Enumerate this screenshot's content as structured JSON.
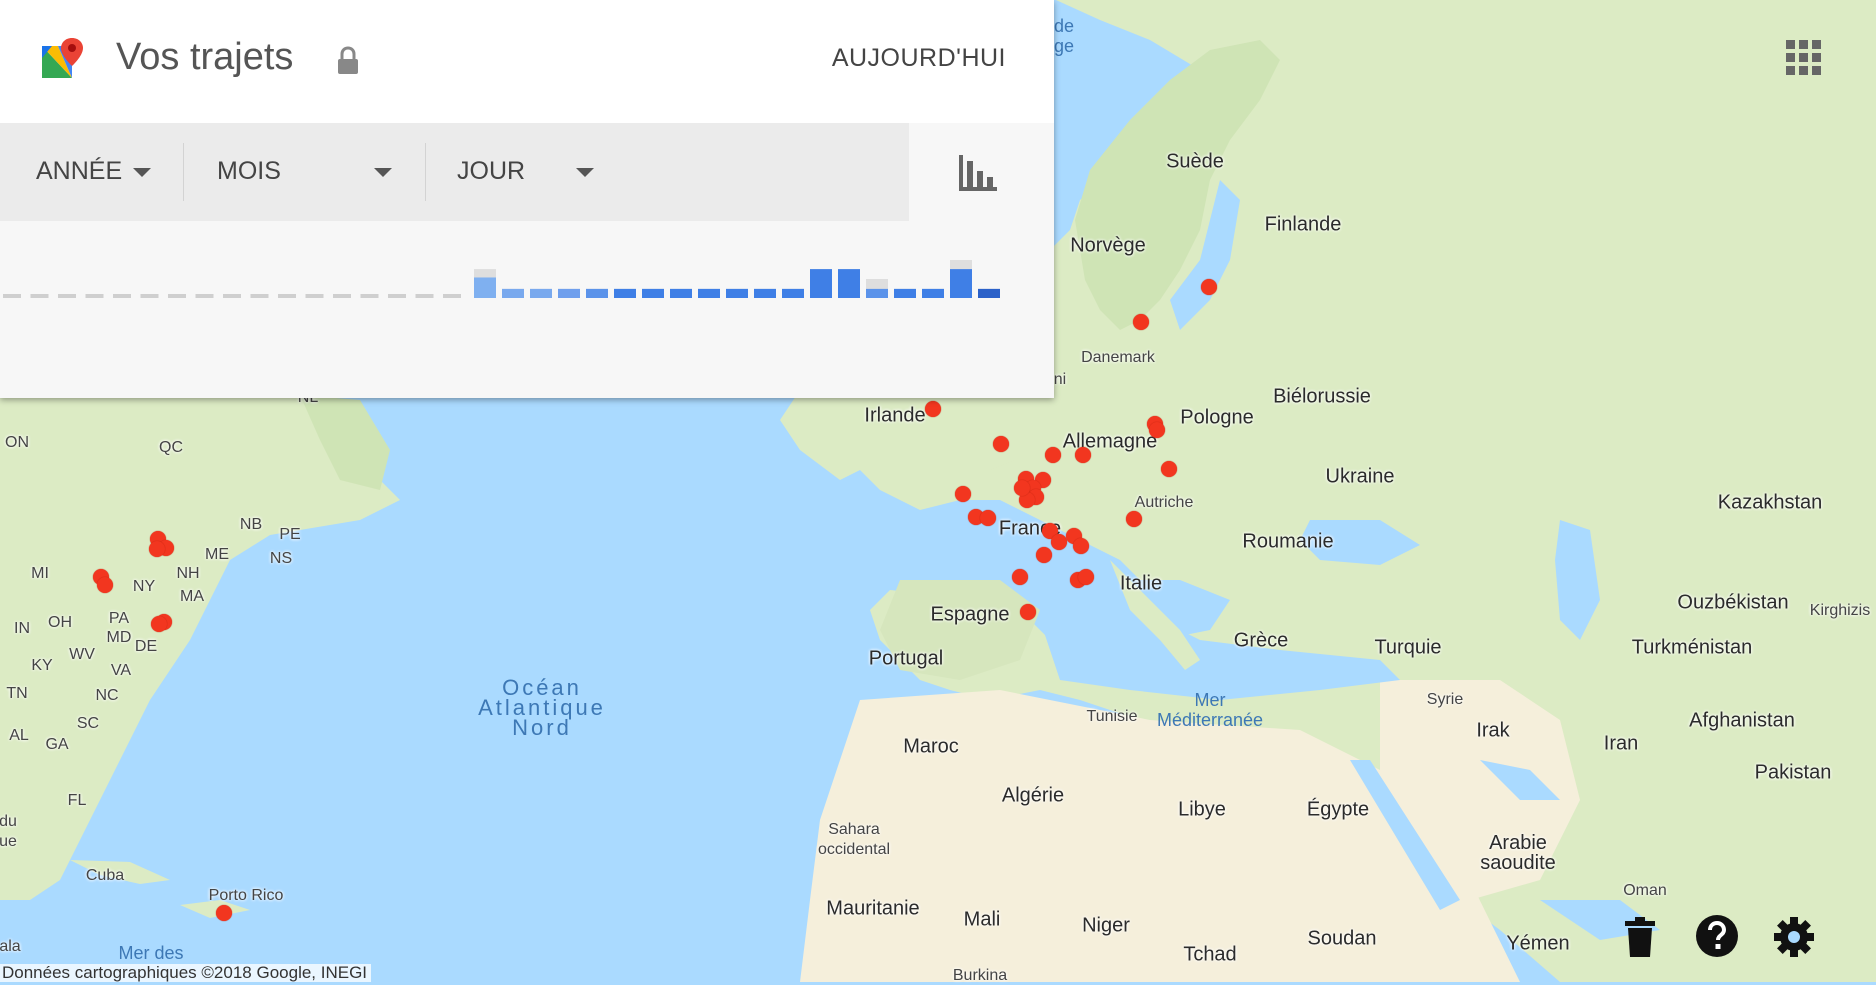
{
  "header": {
    "title": "Vos trajets",
    "today_button": "AUJOURD'HUI"
  },
  "filters": {
    "year": "ANNÉE",
    "month": "MOIS",
    "day": "JOUR"
  },
  "histogram": {
    "empty_bars": 17,
    "bars": [
      {
        "value": 0.27,
        "bg": 0.38,
        "color": "#7fb0f0"
      },
      {
        "value": 0.12,
        "bg": 0.12,
        "color": "#79a9ee"
      },
      {
        "value": 0.12,
        "bg": 0.12,
        "color": "#79a9ee"
      },
      {
        "value": 0.12,
        "bg": 0.12,
        "color": "#6f9fed"
      },
      {
        "value": 0.12,
        "bg": 0.12,
        "color": "#5b93ea"
      },
      {
        "value": 0.12,
        "bg": 0.12,
        "color": "#3f7fe6"
      },
      {
        "value": 0.12,
        "bg": 0.12,
        "color": "#3f7fe6"
      },
      {
        "value": 0.12,
        "bg": 0.12,
        "color": "#3f7fe6"
      },
      {
        "value": 0.12,
        "bg": 0.12,
        "color": "#3f7fe6"
      },
      {
        "value": 0.12,
        "bg": 0.12,
        "color": "#3f7fe6"
      },
      {
        "value": 0.12,
        "bg": 0.12,
        "color": "#3f7fe6"
      },
      {
        "value": 0.12,
        "bg": 0.12,
        "color": "#3f7fe6"
      },
      {
        "value": 0.38,
        "bg": 0.38,
        "color": "#3f7fe6"
      },
      {
        "value": 0.38,
        "bg": 0.38,
        "color": "#3f7fe6"
      },
      {
        "value": 0.12,
        "bg": 0.25,
        "color": "#5b93ea"
      },
      {
        "value": 0.12,
        "bg": 0.12,
        "color": "#3f7fe6"
      },
      {
        "value": 0.12,
        "bg": 0.12,
        "color": "#3f7fe6"
      },
      {
        "value": 0.38,
        "bg": 0.5,
        "color": "#3f7fe6"
      },
      {
        "value": 0.12,
        "bg": 0.12,
        "color": "#2b61c9"
      }
    ]
  },
  "map": {
    "labels": [
      {
        "text": "Suède"
      },
      {
        "text": "Finlande"
      },
      {
        "text": "Norvège"
      },
      {
        "text": "Danemark"
      },
      {
        "text": "Irlande"
      },
      {
        "text": "Pologne"
      },
      {
        "text": "Biélorussie"
      },
      {
        "text": "Allemagne"
      },
      {
        "text": "Ukraine"
      },
      {
        "text": "Autriche"
      },
      {
        "text": "France"
      },
      {
        "text": "Roumanie"
      },
      {
        "text": "Kazakhstan"
      },
      {
        "text": "Italie"
      },
      {
        "text": "Espagne"
      },
      {
        "text": "Portugal"
      },
      {
        "text": "Grèce"
      },
      {
        "text": "Turquie"
      },
      {
        "text": "Ouzbékistan"
      },
      {
        "text": "Kirghizis"
      },
      {
        "text": "Turkménistan"
      },
      {
        "text": "Syrie"
      },
      {
        "text": "Tunisie"
      },
      {
        "text": "Irak"
      },
      {
        "text": "Afghanistan"
      },
      {
        "text": "Iran"
      },
      {
        "text": "Maroc"
      },
      {
        "text": "Pakistan"
      },
      {
        "text": "Algérie"
      },
      {
        "text": "Libye"
      },
      {
        "text": "Égypte"
      },
      {
        "text": "Sahara\noccidental"
      },
      {
        "text": "Arabie\nsaoudite"
      },
      {
        "text": "Oman"
      },
      {
        "text": "Mauritanie"
      },
      {
        "text": "Mali"
      },
      {
        "text": "Niger"
      },
      {
        "text": "Soudan"
      },
      {
        "text": "Tchad"
      },
      {
        "text": "Yémen"
      },
      {
        "text": "Burkina"
      },
      {
        "text": "Cuba"
      },
      {
        "text": "Porto Rico"
      },
      {
        "text": "ON"
      },
      {
        "text": "QC"
      },
      {
        "text": "NL"
      },
      {
        "text": "NB"
      },
      {
        "text": "PE"
      },
      {
        "text": "NS"
      },
      {
        "text": "ME"
      },
      {
        "text": "NH"
      },
      {
        "text": "MA"
      },
      {
        "text": "NY"
      },
      {
        "text": "MI"
      },
      {
        "text": "PA"
      },
      {
        "text": "OH"
      },
      {
        "text": "IN"
      },
      {
        "text": "MD"
      },
      {
        "text": "DE"
      },
      {
        "text": "WV"
      },
      {
        "text": "KY"
      },
      {
        "text": "VA"
      },
      {
        "text": "TN"
      },
      {
        "text": "NC"
      },
      {
        "text": "SC"
      },
      {
        "text": "AL"
      },
      {
        "text": "GA"
      },
      {
        "text": "FL"
      },
      {
        "text": "du\nue"
      },
      {
        "text": "ala"
      },
      {
        "text": "Océan\nAtlantique\nNord"
      },
      {
        "text": "Mer\nMéditerranée"
      },
      {
        "text": "Mer des"
      },
      {
        "text": "de\nge"
      },
      {
        "text": "ni"
      }
    ],
    "visit_count": 36
  },
  "attribution": "Données cartographiques ©2018 Google, INEGI",
  "icons": {
    "logo": "google-maps-logo-icon",
    "lock": "lock-icon",
    "stats": "bar-chart-icon",
    "apps": "apps-grid-icon",
    "trash": "trash-icon",
    "help": "help-icon",
    "settings": "gear-icon"
  },
  "colors": {
    "ocean": "#aadaff",
    "land": "#e7f2d9",
    "desert": "#f5efdb",
    "visit_dot": "#f2361f",
    "bar_blue": "#3f7fe6"
  }
}
